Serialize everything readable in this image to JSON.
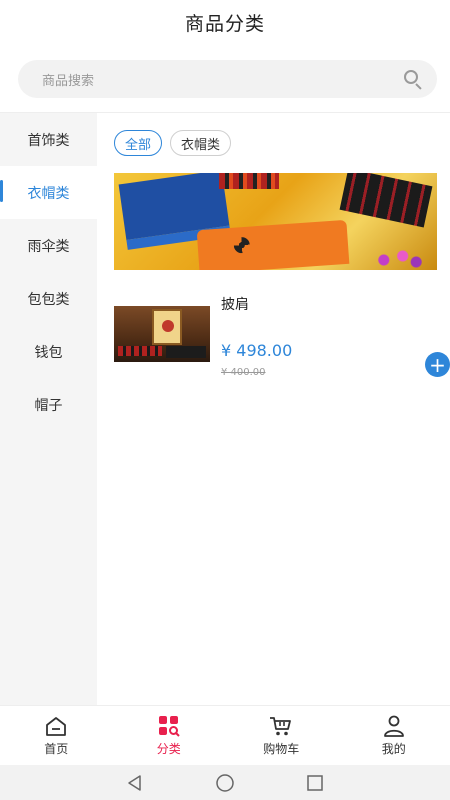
{
  "header": {
    "title": "商品分类"
  },
  "search": {
    "placeholder": "商品搜索",
    "icon": "search-icon"
  },
  "sidebar": {
    "items": [
      {
        "label": "首饰类",
        "active": false
      },
      {
        "label": "衣帽类",
        "active": true
      },
      {
        "label": "雨伞类",
        "active": false
      },
      {
        "label": "包包类",
        "active": false
      },
      {
        "label": "钱包",
        "active": false
      },
      {
        "label": "帽子",
        "active": false
      }
    ]
  },
  "filters": {
    "chips": [
      {
        "label": "全部",
        "active": true
      },
      {
        "label": "衣帽类",
        "active": false
      }
    ]
  },
  "products": [
    {
      "name": "披肩",
      "price": "¥ 498.00",
      "original_price": "¥ 400.00"
    }
  ],
  "tabbar": {
    "items": [
      {
        "label": "首页",
        "icon": "home-icon",
        "active": false
      },
      {
        "label": "分类",
        "icon": "category-icon",
        "active": true
      },
      {
        "label": "购物车",
        "icon": "cart-icon",
        "active": false
      },
      {
        "label": "我的",
        "icon": "user-icon",
        "active": false
      }
    ]
  },
  "colors": {
    "accent": "#2e86d9",
    "tab_active": "#e8204d"
  }
}
